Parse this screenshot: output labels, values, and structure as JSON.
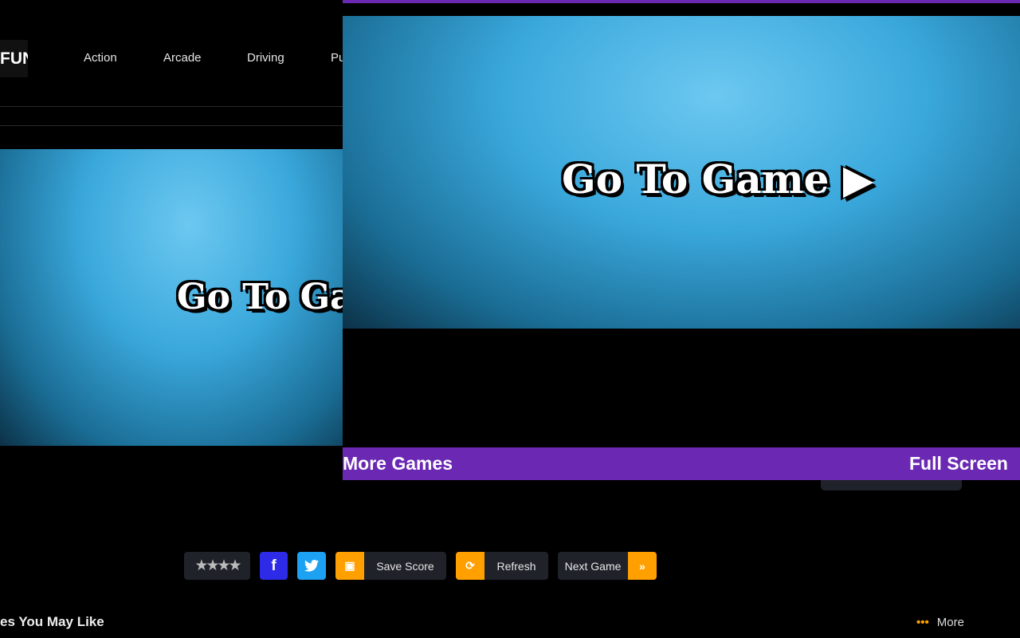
{
  "header": {
    "logo_text": "FUN",
    "nav": [
      "Action",
      "Arcade",
      "Driving",
      "Pu"
    ]
  },
  "game": {
    "title": "Go To Game",
    "play_icon": "play-triangle-icon",
    "bg_color": "#3aa8dc"
  },
  "overlay": {
    "more_games": "More Games",
    "full_screen": "Full Screen",
    "accent": "#6b28b3"
  },
  "toolbar": {
    "rating_stars": 4,
    "facebook_icon": "f",
    "save_score": "Save Score",
    "refresh": "Refresh",
    "next_game": "Next Game",
    "next_icon": "»",
    "accent": "#ffa000"
  },
  "related": {
    "heading": "es You May Like",
    "more": "More"
  }
}
